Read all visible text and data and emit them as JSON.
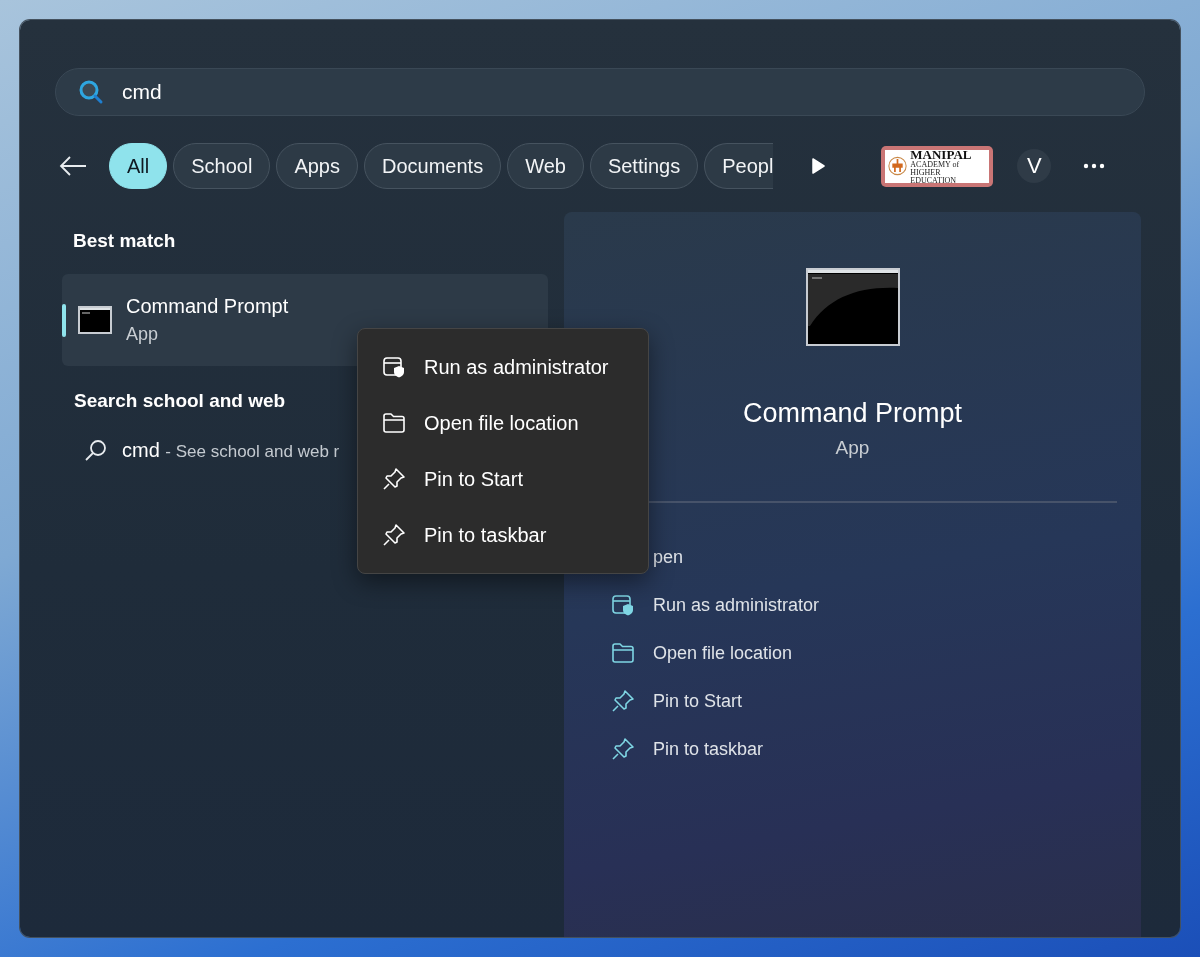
{
  "search": {
    "value": "cmd"
  },
  "filters": [
    {
      "label": "All",
      "selected": true
    },
    {
      "label": "School",
      "selected": false
    },
    {
      "label": "Apps",
      "selected": false
    },
    {
      "label": "Documents",
      "selected": false
    },
    {
      "label": "Web",
      "selected": false
    },
    {
      "label": "Settings",
      "selected": false
    },
    {
      "label": "Peopl",
      "selected": false,
      "cut": true
    }
  ],
  "org_logo": {
    "name": "MANIPAL",
    "subtitle": "ACADEMY of HIGHER EDUCATION"
  },
  "account": {
    "initial": "V"
  },
  "best_match": {
    "heading": "Best match",
    "item": {
      "title": "Command Prompt",
      "subtitle": "App",
      "selected": true
    }
  },
  "web_search": {
    "heading": "Search school and web",
    "query": "cmd",
    "suffix": "- See school and web r"
  },
  "context_menu": [
    {
      "kind": "shield",
      "label": "Run as administrator"
    },
    {
      "kind": "folder",
      "label": "Open file location"
    },
    {
      "kind": "pin",
      "label": "Pin to Start"
    },
    {
      "kind": "pin",
      "label": "Pin to taskbar"
    }
  ],
  "preview": {
    "title": "Command Prompt",
    "subtitle": "App",
    "actions": [
      {
        "label": "pen"
      },
      {
        "kind": "shield",
        "label": "Run as administrator"
      },
      {
        "kind": "folder",
        "label": "Open file location"
      },
      {
        "kind": "pin",
        "label": "Pin to Start"
      },
      {
        "kind": "pin",
        "label": "Pin to taskbar"
      }
    ]
  }
}
